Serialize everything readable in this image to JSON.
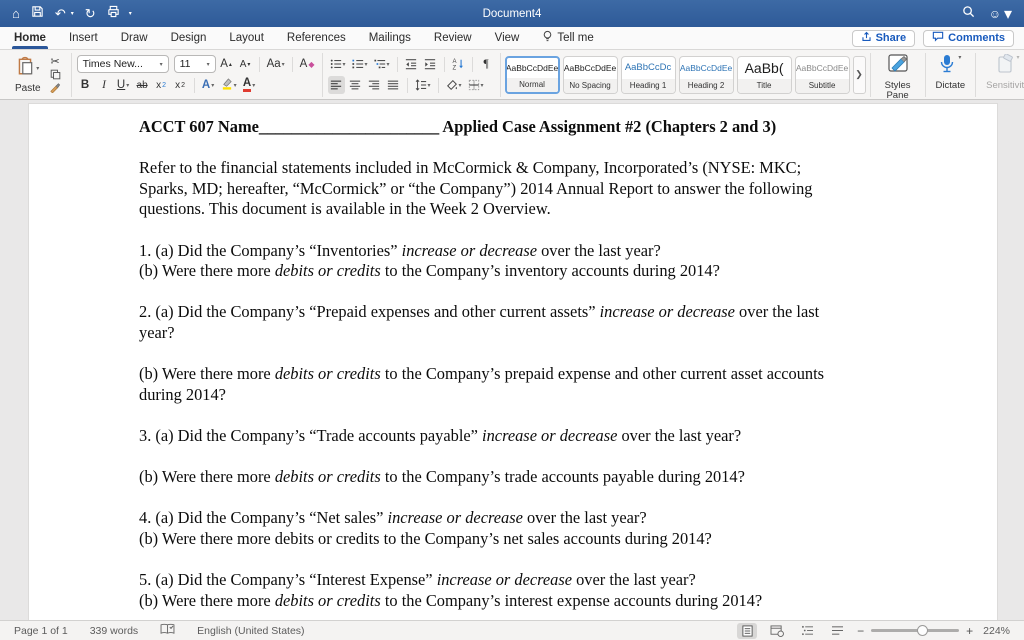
{
  "titlebar": {
    "title": "Document4"
  },
  "tabs": {
    "items": [
      "Home",
      "Insert",
      "Draw",
      "Design",
      "Layout",
      "References",
      "Mailings",
      "Review",
      "View"
    ],
    "active": "Home",
    "tellme": "Tell me"
  },
  "actions": {
    "share": "Share",
    "comments": "Comments"
  },
  "ribbon": {
    "paste_label": "Paste",
    "font_name": "Times New...",
    "font_size": "11",
    "grow_font": "A",
    "shrink_font": "A",
    "change_case": "Aa",
    "clear_format": "A",
    "bold": "B",
    "italic": "I",
    "underline": "U",
    "strikethrough": "ab",
    "sub_base": "x",
    "sub_digit": "2",
    "sup_base": "x",
    "sup_digit": "2",
    "text_effects": "A",
    "font_color": "A",
    "pilcrow": "¶",
    "styles": [
      {
        "sample": "AaBbCcDdEe",
        "label": "Normal"
      },
      {
        "sample": "AaBbCcDdEe",
        "label": "No Spacing"
      },
      {
        "sample": "AaBbCcDc",
        "label": "Heading 1"
      },
      {
        "sample": "AaBbCcDdEe",
        "label": "Heading 2"
      },
      {
        "sample": "AaBb(",
        "label": "Title"
      },
      {
        "sample": "AaBbCcDdEe",
        "label": "Subtitle"
      }
    ],
    "styles_pane": "Styles Pane",
    "dictate": "Dictate",
    "sensitivity": "Sensitivity",
    "colors": {
      "accent_blue": "#2b579a",
      "heading_blue": "#2e74b5",
      "dictate_blue": "#2b7cd3",
      "highlight_yellow": "#ffe100",
      "fontcolor_red": "#e03c31"
    }
  },
  "document": {
    "title_segments": [
      {
        "t": "ACCT 607 Name"
      },
      {
        "t": "______________________"
      },
      {
        "t": " Applied Case Assignment #2 (Chapters 2 and 3)"
      }
    ],
    "paragraphs": [
      {
        "segments": [
          {
            "t": "Refer to the financial statements included in McCormick & Company, Incorporated’s (NYSE: MKC;\nSparks, MD; hereafter, “McCormick” or “the Company”) 2014 Annual Report to answer the following\nquestions. This document is available in the Week 2 Overview."
          }
        ]
      },
      {
        "segments": [
          {
            "t": "1. (a) Did the Company’s “Inventories” "
          },
          {
            "t": "increase or decrease",
            "i": true
          },
          {
            "t": " over the last year?\n(b) Were there more "
          },
          {
            "t": "debits or credits",
            "i": true
          },
          {
            "t": " to the Company’s inventory accounts during 2014?"
          }
        ]
      },
      {
        "segments": [
          {
            "t": "2. (a) Did the Company’s “Prepaid expenses and other current assets” "
          },
          {
            "t": "increase or decrease",
            "i": true
          },
          {
            "t": " over the last\nyear?"
          }
        ]
      },
      {
        "segments": [
          {
            "t": "(b) Were there more "
          },
          {
            "t": "debits or credits",
            "i": true
          },
          {
            "t": " to the Company’s prepaid expense and other current asset accounts\nduring 2014?"
          }
        ]
      },
      {
        "segments": [
          {
            "t": "3. (a) Did the Company’s “Trade accounts payable” "
          },
          {
            "t": "increase or decrease",
            "i": true
          },
          {
            "t": " over the last year?"
          }
        ]
      },
      {
        "segments": [
          {
            "t": "(b) Were there more "
          },
          {
            "t": "debits or credits",
            "i": true
          },
          {
            "t": " to the Company’s trade accounts payable during 2014?"
          }
        ]
      },
      {
        "segments": [
          {
            "t": "4. (a) Did the Company’s “Net sales” "
          },
          {
            "t": "increase or decrease",
            "i": true
          },
          {
            "t": " over the last year?\n(b) Were there more debits or credits to the Company’s net sales accounts during 2014?"
          }
        ]
      },
      {
        "segments": [
          {
            "t": "5. (a) Did the Company’s “Interest Expense” "
          },
          {
            "t": "increase or decrease",
            "i": true
          },
          {
            "t": " over the last year?\n(b) Were there more "
          },
          {
            "t": "debits or credits",
            "i": true
          },
          {
            "t": " to the Company’s interest expense accounts during 2014?"
          }
        ]
      }
    ]
  },
  "statusbar": {
    "page": "Page 1 of 1",
    "words": "339 words",
    "language": "English (United States)",
    "zoom": "224%"
  }
}
